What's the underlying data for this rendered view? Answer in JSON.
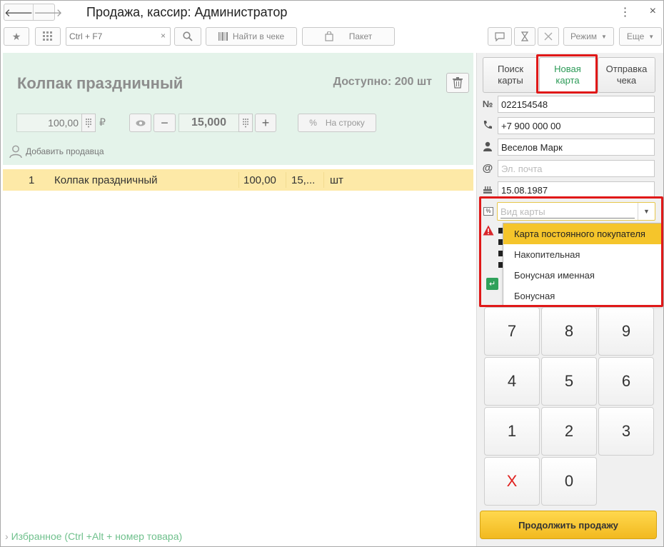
{
  "window": {
    "title": "Продажа, кассир: Администратор"
  },
  "toolbar": {
    "search_placeholder": "Ctrl + F7",
    "clear": "×",
    "find_in_receipt": "Найти в чеке",
    "package": "Пакет",
    "mode": "Режим",
    "more": "Еще"
  },
  "product": {
    "name": "Колпак праздничный",
    "available": "Доступно: 200 шт",
    "price": "100,00",
    "currency": "₽",
    "quantity": "15,000",
    "discount_label": "На строку",
    "add_seller": "Добавить продавца"
  },
  "lines": [
    {
      "num": "1",
      "name": "Колпак праздничный",
      "price": "100,00",
      "qty": "15,...",
      "unit": "шт"
    }
  ],
  "favorites": "Избранное (Ctrl +Alt + номер товара)",
  "card_panel": {
    "tabs": [
      {
        "label_1": "Поиск",
        "label_2": "карты"
      },
      {
        "label_1": "Новая",
        "label_2": "карта"
      },
      {
        "label_1": "Отправка",
        "label_2": "чека"
      }
    ],
    "card_number": "022154548",
    "phone": "+7 900 000 00",
    "name": "Веселов Марк",
    "email_placeholder": "Эл. почта",
    "birthdate": "15.08.1987",
    "card_type_placeholder": "Вид карты",
    "card_type_options": [
      "Карта постоянного покупателя",
      "Накопительная",
      "Бонусная именная",
      "Бонусная"
    ]
  },
  "numpad": {
    "keys": [
      "7",
      "8",
      "9",
      "4",
      "5",
      "6",
      "1",
      "2",
      "3",
      "X",
      "0"
    ]
  },
  "continue_label": "Продолжить продажу",
  "colors": {
    "accent_green": "#2d9b58",
    "highlight_yellow": "#f5c52b",
    "product_bg": "#e4f3ea",
    "line_bg": "#fde9a7",
    "annotation_red": "#e01818"
  }
}
